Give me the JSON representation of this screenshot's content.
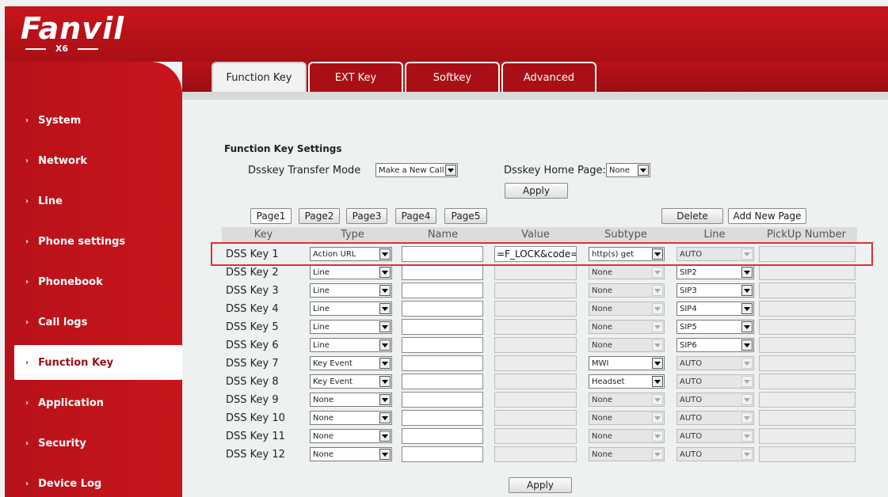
{
  "brand": {
    "logo": "Fanvil",
    "model": "X6"
  },
  "sidebar": {
    "items": [
      {
        "label": "System"
      },
      {
        "label": "Network"
      },
      {
        "label": "Line"
      },
      {
        "label": "Phone settings"
      },
      {
        "label": "Phonebook"
      },
      {
        "label": "Call logs"
      },
      {
        "label": "Function Key"
      },
      {
        "label": "Application"
      },
      {
        "label": "Security"
      },
      {
        "label": "Device Log"
      }
    ],
    "active": "Function Key"
  },
  "tabs": [
    {
      "label": "Function Key"
    },
    {
      "label": "EXT Key"
    },
    {
      "label": "Softkey"
    },
    {
      "label": "Advanced"
    }
  ],
  "settings": {
    "title": "Function Key Settings",
    "transfer_mode_label": "Dsskey Transfer Mode",
    "transfer_mode_value": "Make a New Call",
    "home_page_label": "Dsskey Home Page:",
    "home_page_value": "None",
    "apply_label": "Apply"
  },
  "pages": {
    "buttons": [
      "Page1",
      "Page2",
      "Page3",
      "Page4",
      "Page5"
    ],
    "delete": "Delete",
    "add_new": "Add New Page"
  },
  "table": {
    "headers": [
      "Key",
      "Type",
      "Name",
      "Value",
      "Subtype",
      "Line",
      "PickUp Number"
    ],
    "rows": [
      {
        "key": "DSS Key 1",
        "type": "Action URL",
        "name": "",
        "value": "=F_LOCK&code=*",
        "subtype": "http(s) get",
        "line": "AUTO"
      },
      {
        "key": "DSS Key 2",
        "type": "Line",
        "name": "",
        "value": "",
        "subtype": "None",
        "line": "SIP2"
      },
      {
        "key": "DSS Key 3",
        "type": "Line",
        "name": "",
        "value": "",
        "subtype": "None",
        "line": "SIP3"
      },
      {
        "key": "DSS Key 4",
        "type": "Line",
        "name": "",
        "value": "",
        "subtype": "None",
        "line": "SIP4"
      },
      {
        "key": "DSS Key 5",
        "type": "Line",
        "name": "",
        "value": "",
        "subtype": "None",
        "line": "SIP5"
      },
      {
        "key": "DSS Key 6",
        "type": "Line",
        "name": "",
        "value": "",
        "subtype": "None",
        "line": "SIP6"
      },
      {
        "key": "DSS Key 7",
        "type": "Key Event",
        "name": "",
        "value": "",
        "subtype": "MWI",
        "line": "AUTO"
      },
      {
        "key": "DSS Key 8",
        "type": "Key Event",
        "name": "",
        "value": "",
        "subtype": "Headset",
        "line": "AUTO"
      },
      {
        "key": "DSS Key 9",
        "type": "None",
        "name": "",
        "value": "",
        "subtype": "None",
        "line": "AUTO"
      },
      {
        "key": "DSS Key 10",
        "type": "None",
        "name": "",
        "value": "",
        "subtype": "None",
        "line": "AUTO"
      },
      {
        "key": "DSS Key 11",
        "type": "None",
        "name": "",
        "value": "",
        "subtype": "None",
        "line": "AUTO"
      },
      {
        "key": "DSS Key 12",
        "type": "None",
        "name": "",
        "value": "",
        "subtype": "None",
        "line": "AUTO"
      }
    ]
  },
  "footer": {
    "apply_label": "Apply"
  },
  "colors": {
    "brand_red": "#c8151c",
    "highlight": "#e03030"
  }
}
